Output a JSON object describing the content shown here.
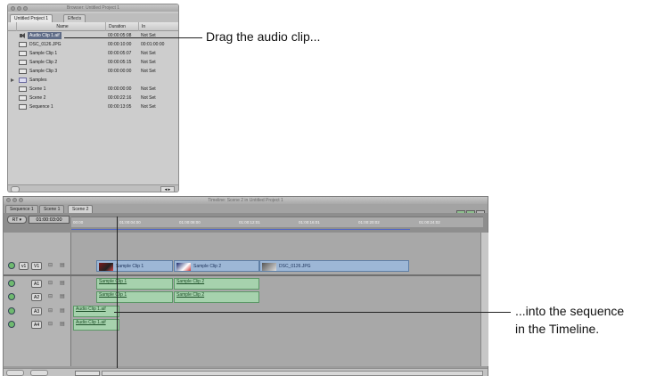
{
  "browser": {
    "window_title": "Browser: Untitled Project 1",
    "tabs": [
      "Untitled Project 1",
      "Effects"
    ],
    "columns": [
      "Name",
      "Duration",
      "In"
    ],
    "items": [
      {
        "name": "Audio Clip 1.aif",
        "icon": "speaker-icon",
        "duration": "00:00:05:08",
        "in": "Not Set",
        "selected": true
      },
      {
        "name": "DSC_0126.JPG",
        "icon": "still-image-icon",
        "duration": "00:00:10:00",
        "in": "00:01:00:00"
      },
      {
        "name": "Sample Clip 1",
        "icon": "clip-icon",
        "duration": "00:00:05:07",
        "in": "Not Set"
      },
      {
        "name": "Sample Clip 2",
        "icon": "clip-icon",
        "duration": "00:00:05:15",
        "in": "Not Set"
      },
      {
        "name": "Sample Clip 3",
        "icon": "clip-icon",
        "duration": "00:00:00:00",
        "in": "Not Set"
      },
      {
        "name": "Samples",
        "icon": "folder-icon",
        "duration": "",
        "in": ""
      },
      {
        "name": "Scene 1",
        "icon": "sequence-icon",
        "duration": "00:00:00:00",
        "in": "Not Set"
      },
      {
        "name": "Scene 2",
        "icon": "sequence-icon",
        "duration": "00:00:22:16",
        "in": "Not Set"
      },
      {
        "name": "Sequence 1",
        "icon": "sequence-icon",
        "duration": "00:00:13:05",
        "in": "Not Set"
      }
    ]
  },
  "timeline": {
    "window_title": "Timeline: Scene 2 in Untitled Project 1",
    "tabs": [
      "Sequence 1",
      "Scene 1",
      "Scene 2"
    ],
    "rt_label": "RT",
    "timecode": "01:00:03:00",
    "ruler_ticks": [
      "00:00",
      "01:00:04:00",
      "01:00:08:00",
      "01:00:12:01",
      "01:00:16:01",
      "01:00:20:02",
      "01:00:24:02"
    ],
    "tracks": [
      {
        "src": "v1",
        "dst": "V1"
      },
      {
        "src": "",
        "dst": "A1"
      },
      {
        "src": "",
        "dst": "A2"
      },
      {
        "src": "",
        "dst": "A3"
      },
      {
        "src": "",
        "dst": "A4"
      }
    ],
    "video_clips": [
      "Sample Clip 1",
      "Sample Clip 2",
      "DSC_0126.JPG"
    ],
    "audio_clips_a1": [
      "Sample Clip 1",
      "Sample Clip 2"
    ],
    "audio_clips_a2": [
      "Sample Clip 1",
      "Sample Clip 2"
    ],
    "audio_clips_a3": [
      "Audio Clip 1.aif"
    ],
    "audio_clips_a4": [
      "Audio Clip 1.aif"
    ]
  },
  "callouts": {
    "drag": "Drag the audio clip...",
    "into_line1": "...into the sequence",
    "into_line2": "in the Timeline."
  }
}
